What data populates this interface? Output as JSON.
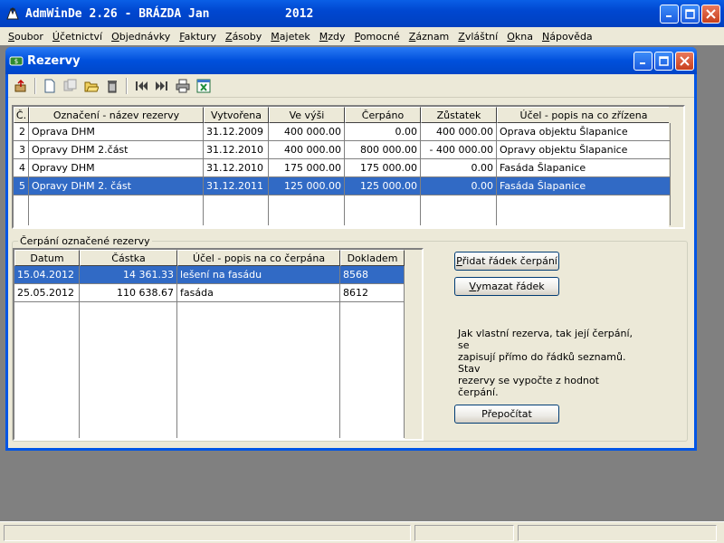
{
  "app": {
    "title": "AdmWinDe 2.26 - BRÁZDA Jan",
    "year": "2012"
  },
  "menu": [
    {
      "first": "S",
      "rest": "oubor"
    },
    {
      "first": "Ú",
      "rest": "četnictví"
    },
    {
      "first": "O",
      "rest": "bjednávky"
    },
    {
      "first": "F",
      "rest": "aktury"
    },
    {
      "first": "Z",
      "rest": "ásoby"
    },
    {
      "first": "M",
      "rest": "ajetek"
    },
    {
      "first": "M",
      "rest": "zdy"
    },
    {
      "first": "P",
      "rest": "omocné"
    },
    {
      "first": "Z",
      "rest": "áznam"
    },
    {
      "first": "Z",
      "rest": "vláštní"
    },
    {
      "first": "O",
      "rest": "kna"
    },
    {
      "first": "N",
      "rest": "ápověda"
    }
  ],
  "window": {
    "title": "Rezervy"
  },
  "toolbar_icons": [
    "export-icon",
    "new-record-icon",
    "copy-record-icon",
    "open-folder-icon",
    "delete-icon",
    "first-record-icon",
    "last-record-icon",
    "print-icon",
    "excel-export-icon"
  ],
  "reserves": {
    "headers": [
      "Č.",
      "Označení - název rezervy",
      "Vytvořena",
      "Ve výši",
      "Čerpáno",
      "Zůstatek",
      "Účel - popis na co zřízena"
    ],
    "rows": [
      {
        "no": "2",
        "name": "Oprava DHM",
        "created": "31.12.2009",
        "amount": "400 000.00",
        "drawn": "0.00",
        "balance": "400 000.00",
        "purpose": "Oprava objektu Šlapanice"
      },
      {
        "no": "3",
        "name": "Opravy DHM 2.část",
        "created": "31.12.2010",
        "amount": "400 000.00",
        "drawn": "800 000.00",
        "balance": "- 400 000.00",
        "purpose": "Opravy objektu Šlapanice"
      },
      {
        "no": "4",
        "name": "Opravy DHM",
        "created": "31.12.2010",
        "amount": "175 000.00",
        "drawn": "175 000.00",
        "balance": "0.00",
        "purpose": "Fasáda Šlapanice"
      },
      {
        "no": "5",
        "name": "Opravy DHM 2. část",
        "created": "31.12.2011",
        "amount": "125 000.00",
        "drawn": "125 000.00",
        "balance": "0.00",
        "purpose": "Fasáda Šlapanice"
      }
    ]
  },
  "drawings": {
    "group_label": "Čerpání označené rezervy",
    "headers": [
      "Datum",
      "Částka",
      "Účel - popis na co čerpána",
      "Dokladem"
    ],
    "rows": [
      {
        "date": "15.04.2012",
        "amount": "14 361.33",
        "purpose": "lešení na fasádu",
        "doc": "8568"
      },
      {
        "date": "25.05.2012",
        "amount": "110 638.67",
        "purpose": "fasáda",
        "doc": "8612"
      }
    ]
  },
  "buttons": {
    "add_first": "P",
    "add_rest": "řidat řádek čerpání",
    "delete_first": "V",
    "delete_rest": "ymazat řádek",
    "recalc": "Přepočítat"
  },
  "info_text": {
    "line1": "Jak vlastní rezerva, tak její čerpání, se",
    "line2": "zapisují přímo do řádků seznamů. Stav",
    "line3": "rezervy se vypočte z hodnot čerpání."
  }
}
